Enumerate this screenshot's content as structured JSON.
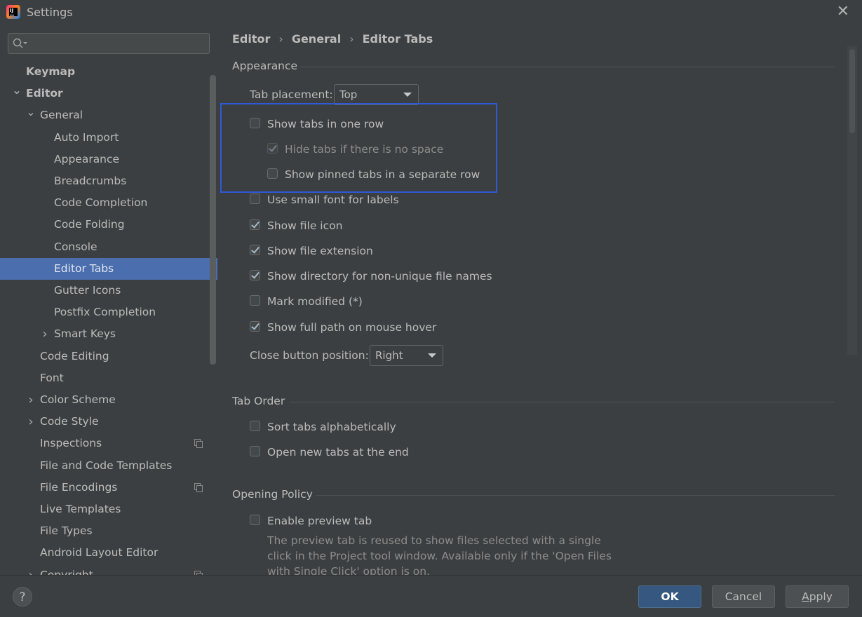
{
  "window": {
    "title": "Settings"
  },
  "search": {
    "placeholder": ""
  },
  "sidebar": {
    "items": [
      {
        "label": "Keymap",
        "indent": 0,
        "bold": true,
        "arrow": ""
      },
      {
        "label": "Editor",
        "indent": 0,
        "bold": true,
        "arrow": "down"
      },
      {
        "label": "General",
        "indent": 1,
        "bold": false,
        "arrow": "down"
      },
      {
        "label": "Auto Import",
        "indent": 2,
        "bold": false,
        "arrow": ""
      },
      {
        "label": "Appearance",
        "indent": 2,
        "bold": false,
        "arrow": ""
      },
      {
        "label": "Breadcrumbs",
        "indent": 2,
        "bold": false,
        "arrow": ""
      },
      {
        "label": "Code Completion",
        "indent": 2,
        "bold": false,
        "arrow": ""
      },
      {
        "label": "Code Folding",
        "indent": 2,
        "bold": false,
        "arrow": ""
      },
      {
        "label": "Console",
        "indent": 2,
        "bold": false,
        "arrow": ""
      },
      {
        "label": "Editor Tabs",
        "indent": 2,
        "bold": false,
        "arrow": "",
        "selected": true
      },
      {
        "label": "Gutter Icons",
        "indent": 2,
        "bold": false,
        "arrow": ""
      },
      {
        "label": "Postfix Completion",
        "indent": 2,
        "bold": false,
        "arrow": ""
      },
      {
        "label": "Smart Keys",
        "indent": 2,
        "bold": false,
        "arrow": "right"
      },
      {
        "label": "Code Editing",
        "indent": 1,
        "bold": false,
        "arrow": ""
      },
      {
        "label": "Font",
        "indent": 1,
        "bold": false,
        "arrow": ""
      },
      {
        "label": "Color Scheme",
        "indent": 1,
        "bold": false,
        "arrow": "right"
      },
      {
        "label": "Code Style",
        "indent": 1,
        "bold": false,
        "arrow": "right"
      },
      {
        "label": "Inspections",
        "indent": 1,
        "bold": false,
        "arrow": "",
        "icon": "copy-icon"
      },
      {
        "label": "File and Code Templates",
        "indent": 1,
        "bold": false,
        "arrow": ""
      },
      {
        "label": "File Encodings",
        "indent": 1,
        "bold": false,
        "arrow": "",
        "icon": "copy-icon"
      },
      {
        "label": "Live Templates",
        "indent": 1,
        "bold": false,
        "arrow": ""
      },
      {
        "label": "File Types",
        "indent": 1,
        "bold": false,
        "arrow": ""
      },
      {
        "label": "Android Layout Editor",
        "indent": 1,
        "bold": false,
        "arrow": ""
      },
      {
        "label": "Copyright",
        "indent": 1,
        "bold": false,
        "arrow": "right",
        "icon": "copy-icon"
      }
    ]
  },
  "breadcrumb": {
    "parts": [
      "Editor",
      "General",
      "Editor Tabs"
    ],
    "separator": "›"
  },
  "appearance": {
    "title": "Appearance",
    "tab_placement_label": "Tab placement:",
    "tab_placement_value": "Top",
    "options": [
      {
        "label": "Show tabs in one row",
        "checked": false,
        "disabled": false
      },
      {
        "label": "Hide tabs if there is no space",
        "checked": true,
        "disabled": true
      },
      {
        "label": "Show pinned tabs in a separate row",
        "checked": false,
        "disabled": false
      },
      {
        "label": "Use small font for labels",
        "checked": false,
        "disabled": false
      },
      {
        "label": "Show file icon",
        "checked": true,
        "disabled": false
      },
      {
        "label": "Show file extension",
        "checked": true,
        "disabled": false
      },
      {
        "label": "Show directory for non-unique file names",
        "checked": true,
        "disabled": false
      },
      {
        "label": "Mark modified (*)",
        "checked": false,
        "disabled": false
      },
      {
        "label": "Show full path on mouse hover",
        "checked": true,
        "disabled": false
      }
    ],
    "close_button_label": "Close button position:",
    "close_button_value": "Right"
  },
  "tab_order": {
    "title": "Tab Order",
    "options": [
      {
        "label": "Sort tabs alphabetically",
        "checked": false
      },
      {
        "label": "Open new tabs at the end",
        "checked": false
      }
    ]
  },
  "opening_policy": {
    "title": "Opening Policy",
    "preview_label": "Enable preview tab",
    "preview_checked": false,
    "description": "The preview tab is reused to show files selected with a single click in the Project tool window. Available only if the 'Open Files with Single Click' option is on."
  },
  "footer": {
    "help": "?",
    "ok": "OK",
    "cancel": "Cancel",
    "apply_first": "A",
    "apply_rest": "pply"
  },
  "colors": {
    "selection": "#4b6eaf",
    "primary_button": "#365880",
    "highlight_box": "#2f59d6"
  }
}
